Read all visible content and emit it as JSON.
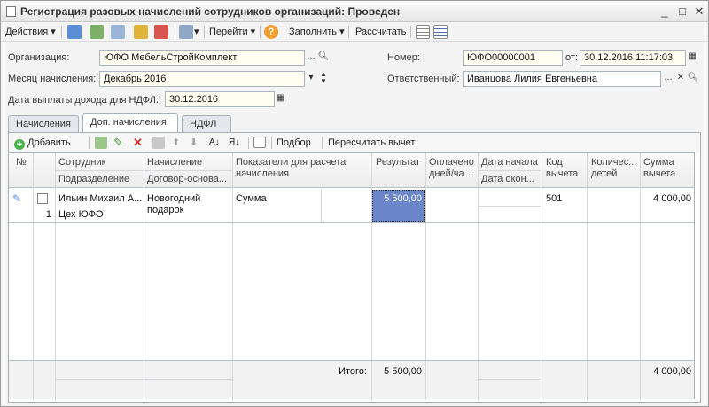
{
  "window": {
    "title": "Регистрация разовых начислений сотрудников организаций: Проведен"
  },
  "toolbar": {
    "actions": "Действия",
    "goto": "Перейти",
    "fill": "Заполнить",
    "calculate": "Рассчитать"
  },
  "form": {
    "org_label": "Организация:",
    "org_value": "ЮФО МебельСтройКомплект",
    "month_label": "Месяц начисления:",
    "month_value": "Декабрь 2016",
    "pay_date_label": "Дата выплаты дохода для НДФЛ:",
    "pay_date_value": "30.12.2016",
    "number_label": "Номер:",
    "number_value": "ЮФО00000001",
    "from_label": "от:",
    "from_value": "30.12.2016 11:17:03",
    "responsible_label": "Ответственный:",
    "responsible_value": "Иванцова Лилия Евгеньевна"
  },
  "tabs": [
    "Начисления",
    "Доп. начисления",
    "НДФЛ"
  ],
  "grid_toolbar": {
    "add": "Добавить",
    "selection": "Подбор",
    "recalc": "Пересчитать вычет"
  },
  "columns": {
    "no": "№",
    "employee": "Сотрудник",
    "department": "Подразделение",
    "accrual": "Начисление",
    "contract": "Договор-основа...",
    "indicators": "Показатели для расчета начисления",
    "result": "Результат",
    "paid": "Оплачено дней/ча...",
    "date_start": "Дата начала",
    "date_end": "Дата окон...",
    "deduction_code": "Код вычета",
    "children_count": "Количес... детей",
    "deduction_sum": "Сумма вычета"
  },
  "rows": [
    {
      "no": "1",
      "employee": "Ильин Михаил А...",
      "department": "Цех ЮФО",
      "accrual": "Новогодний подарок",
      "indicator": "Сумма",
      "result": "5 500,00",
      "deduction_code": "501",
      "deduction_sum": "4 000,00"
    }
  ],
  "totals": {
    "label": "Итого:",
    "result": "5 500,00",
    "deduction_sum": "4 000,00"
  }
}
